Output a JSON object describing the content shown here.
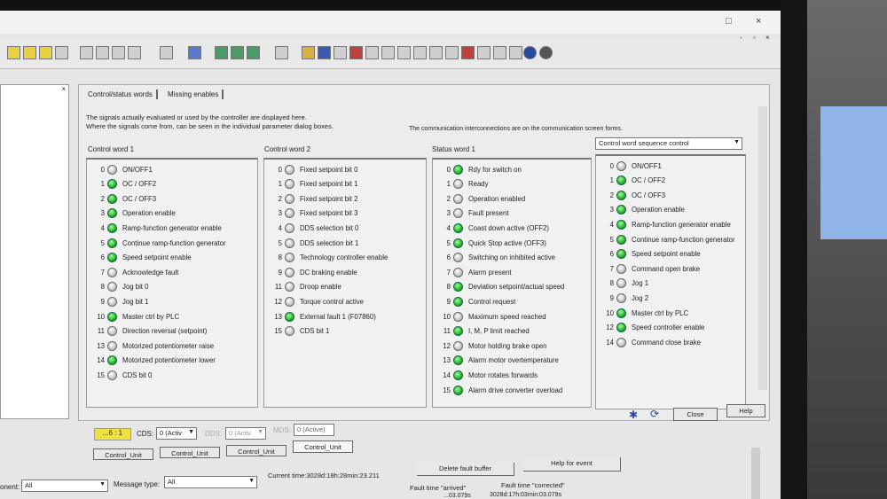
{
  "window": {
    "controls": [
      "□",
      "×"
    ],
    "sub_controls": [
      "-",
      "▫",
      "×"
    ]
  },
  "tabs": [
    "Control/status words",
    "Missing enables"
  ],
  "info": {
    "line1": "The signals actually evaluated or used by the controller are displayed here.",
    "line2": "Where the signals come from, can be seen in the individual parameter dialog boxes.",
    "line3": "The communication interconnections are on the communication screen forms."
  },
  "groups": [
    {
      "title": "Control word 1",
      "rows": [
        {
          "bit": "0",
          "label": "ON/OFF1",
          "on": false
        },
        {
          "bit": "1",
          "label": "OC / OFF2",
          "on": true
        },
        {
          "bit": "2",
          "label": "OC / OFF3",
          "on": true
        },
        {
          "bit": "3",
          "label": "Operation enable",
          "on": true
        },
        {
          "bit": "4",
          "label": "Ramp-function generator enable",
          "on": true
        },
        {
          "bit": "5",
          "label": "Continue ramp-function generator",
          "on": true
        },
        {
          "bit": "6",
          "label": "Speed setpoint enable",
          "on": true
        },
        {
          "bit": "7",
          "label": "Acknowledge fault",
          "on": false
        },
        {
          "bit": "8",
          "label": "Jog bit 0",
          "on": false
        },
        {
          "bit": "9",
          "label": "Jog bit 1",
          "on": false
        },
        {
          "bit": "10",
          "label": "Master ctrl by PLC",
          "on": true
        },
        {
          "bit": "11",
          "label": "Direction reversal (setpoint)",
          "on": false
        },
        {
          "bit": "13",
          "label": "Motorized potentiometer raise",
          "on": false
        },
        {
          "bit": "14",
          "label": "Motorized potentiometer lower",
          "on": true
        },
        {
          "bit": "15",
          "label": "CDS bit 0",
          "on": false
        }
      ]
    },
    {
      "title": "Control word 2",
      "rows": [
        {
          "bit": "0",
          "label": "Fixed setpoint bit 0",
          "on": false
        },
        {
          "bit": "1",
          "label": "Fixed setpoint bit 1",
          "on": false
        },
        {
          "bit": "2",
          "label": "Fixed setpoint bit 2",
          "on": false
        },
        {
          "bit": "3",
          "label": "Fixed setpoint bit 3",
          "on": false
        },
        {
          "bit": "4",
          "label": "DDS selection bit 0",
          "on": false
        },
        {
          "bit": "5",
          "label": "DDS selection bit 1",
          "on": false
        },
        {
          "bit": "8",
          "label": "Technology controller enable",
          "on": false
        },
        {
          "bit": "9",
          "label": "DC braking enable",
          "on": false
        },
        {
          "bit": "11",
          "label": "Droop enable",
          "on": false
        },
        {
          "bit": "12",
          "label": "Torque control active",
          "on": false
        },
        {
          "bit": "13",
          "label": "External fault 1 (F07860)",
          "on": true
        },
        {
          "bit": "15",
          "label": "CDS bit 1",
          "on": false
        }
      ]
    },
    {
      "title": "Status word 1",
      "rows": [
        {
          "bit": "0",
          "label": "Rdy for switch on",
          "on": true
        },
        {
          "bit": "1",
          "label": "Ready",
          "on": false
        },
        {
          "bit": "2",
          "label": "Operation enabled",
          "on": false
        },
        {
          "bit": "3",
          "label": "Fault present",
          "on": false
        },
        {
          "bit": "4",
          "label": "Coast down active (OFF2)",
          "on": true
        },
        {
          "bit": "5",
          "label": "Quick Stop active (OFF3)",
          "on": true
        },
        {
          "bit": "6",
          "label": "Switching on inhibited active",
          "on": false
        },
        {
          "bit": "7",
          "label": "Alarm present",
          "on": false
        },
        {
          "bit": "8",
          "label": "Deviation setpoint/actual speed",
          "on": true
        },
        {
          "bit": "9",
          "label": "Control request",
          "on": true
        },
        {
          "bit": "10",
          "label": "Maximum speed reached",
          "on": false
        },
        {
          "bit": "11",
          "label": "I, M, P limit reached",
          "on": true
        },
        {
          "bit": "12",
          "label": "Motor holding brake open",
          "on": false
        },
        {
          "bit": "13",
          "label": "Alarm motor overtemperature",
          "on": true
        },
        {
          "bit": "14",
          "label": "Motor rotates forwards",
          "on": true
        },
        {
          "bit": "15",
          "label": "Alarm drive converter overload",
          "on": true
        }
      ]
    },
    {
      "title": "Control word sequence control",
      "rows": [
        {
          "bit": "0",
          "label": "ON/OFF1",
          "on": false
        },
        {
          "bit": "1",
          "label": "OC / OFF2",
          "on": true
        },
        {
          "bit": "2",
          "label": "OC / OFF3",
          "on": true
        },
        {
          "bit": "3",
          "label": "Operation enable",
          "on": true
        },
        {
          "bit": "4",
          "label": "Ramp-function generator enable",
          "on": true
        },
        {
          "bit": "5",
          "label": "Continue ramp-function generator",
          "on": true
        },
        {
          "bit": "6",
          "label": "Speed setpoint enable",
          "on": true
        },
        {
          "bit": "7",
          "label": "Command open brake",
          "on": false
        },
        {
          "bit": "8",
          "label": "Jog 1",
          "on": false
        },
        {
          "bit": "9",
          "label": "Jog 2",
          "on": false
        },
        {
          "bit": "10",
          "label": "Master ctrl by PLC",
          "on": true
        },
        {
          "bit": "12",
          "label": "Speed controller enable",
          "on": true
        },
        {
          "bit": "14",
          "label": "Command close brake",
          "on": false
        }
      ]
    }
  ],
  "buttons": {
    "close": "Close",
    "help": "Help"
  },
  "status": {
    "drive": "...6 : 1",
    "cds_label": "CDS:",
    "cds_value": "0 (Activ",
    "dds_label": "DDS:",
    "dds_value": "0 (Activ",
    "mds_label": "MDS:",
    "mds_value": "0 (Active)"
  },
  "bottom_tabs": [
    "Control_Unit",
    "Control_Unit",
    "Control_Unit",
    "Control_Unit"
  ],
  "messages": {
    "component_label": "onent:",
    "component_value": "All",
    "type_label": "Message type:",
    "type_value": "All",
    "current_time": "Current time:3028d:18h:28min:23.211",
    "delete": "Delete fault buffer",
    "help": "Help for event",
    "col_arrived": "Fault time \"arrived\"",
    "col_corrected": "Fault time \"corrected\"",
    "row1_arrived": "...03.079s",
    "row1_corrected": "3028d:17h:03min:03.079s"
  },
  "colors": {
    "led_on": "#2a2",
    "highlight": "#f0e040"
  }
}
